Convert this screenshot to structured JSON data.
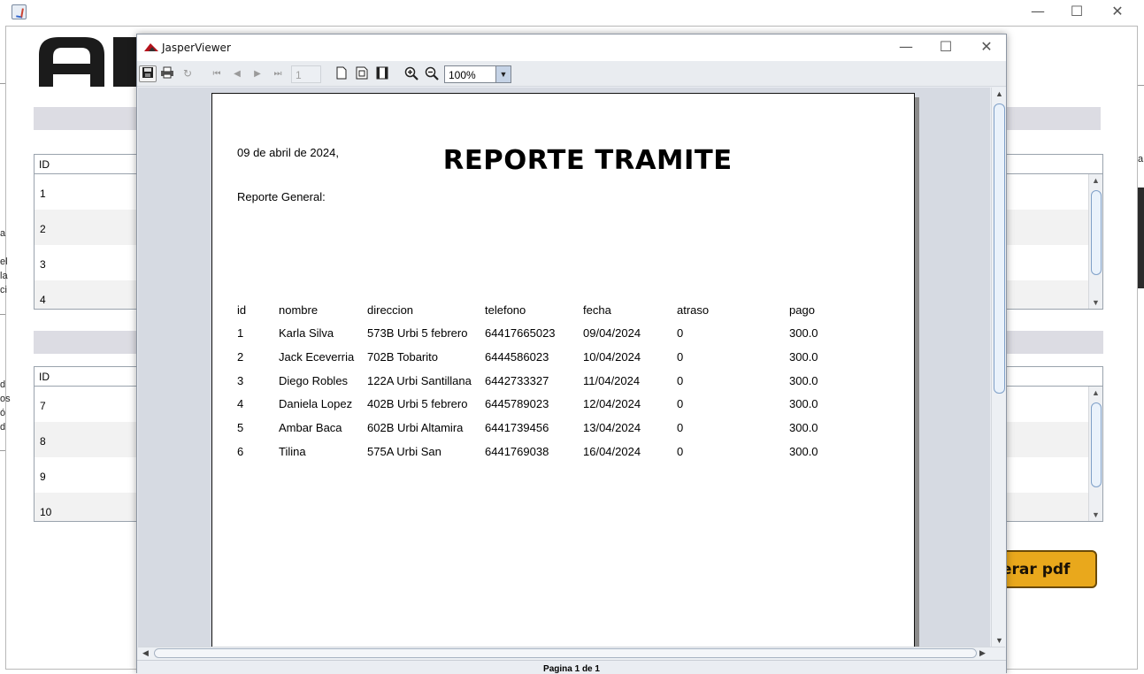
{
  "background_app": {
    "window_controls": [
      "—",
      "☐",
      "✕"
    ],
    "table1": {
      "header": "ID",
      "rows": [
        "1",
        "2",
        "3",
        "4"
      ]
    },
    "table2": {
      "header": "ID",
      "rows": [
        "7",
        "8",
        "9",
        "10"
      ]
    },
    "pdf_button_label": "erar pdf",
    "left_edge_fragments": [
      "a",
      "el",
      "la",
      "ci",
      "d",
      "os",
      "ó",
      "d"
    ],
    "right_edge_fragment": "a"
  },
  "viewer": {
    "title": "JasperViewer",
    "window_controls": [
      "—",
      "☐",
      "✕"
    ],
    "toolbar": {
      "page_value": "1",
      "zoom_value": "100%"
    },
    "status_text": "Pagina 1 de 1"
  },
  "report": {
    "date": "09 de abril de 2024,",
    "title": "REPORTE TRAMITE",
    "subtitle": "Reporte General:",
    "columns": [
      "id",
      "nombre",
      "direccion",
      "telefono",
      "fecha",
      "atraso",
      "pago"
    ],
    "rows": [
      [
        "1",
        "Karla Silva",
        "573B Urbi 5 febrero",
        "64417665023",
        "09/04/2024",
        "0",
        "300.0"
      ],
      [
        "2",
        "Jack Eceverria",
        "702B Tobarito",
        "6444586023",
        "10/04/2024",
        "0",
        "300.0"
      ],
      [
        "3",
        "Diego Robles",
        "122A Urbi Santillana",
        "6442733327",
        "11/04/2024",
        "0",
        "300.0"
      ],
      [
        "4",
        "Daniela Lopez",
        "402B Urbi 5 febrero",
        "6445789023",
        "12/04/2024",
        "0",
        "300.0"
      ],
      [
        "5",
        "Ambar Baca",
        "602B Urbi Altamira",
        "6441739456",
        "13/04/2024",
        "0",
        "300.0"
      ],
      [
        "6",
        "Tilina",
        "575A Urbi San",
        "6441769038",
        "16/04/2024",
        "0",
        "300.0"
      ]
    ]
  }
}
